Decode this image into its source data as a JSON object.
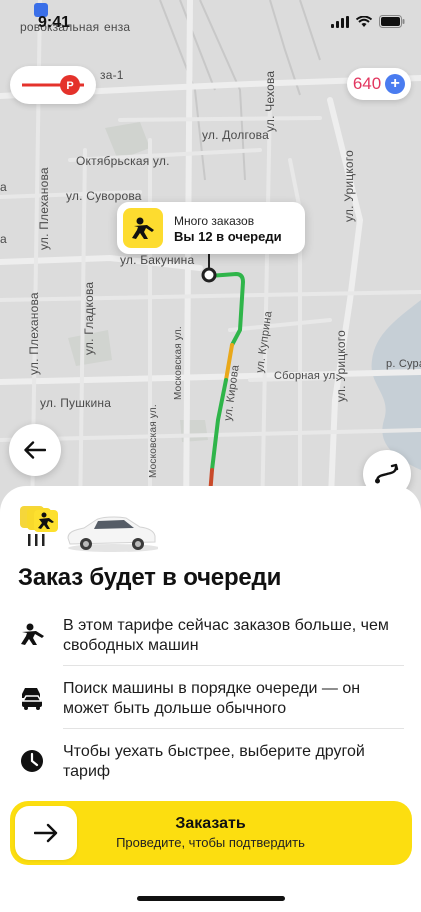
{
  "status_bar": {
    "time": "9:41"
  },
  "map": {
    "streets": {
      "top_left": "ровокзальная",
      "top_left_end": "енза",
      "za1": "за-1",
      "dolgova": "ул. Долгова",
      "oktyabrskaya": "Октябрьская ул.",
      "suvorova": "ул. Суворова",
      "bakunina": "ул. Бакунина",
      "chekhova": "ул. Чехова",
      "uritskogo_top": "ул. Урицкого",
      "uritskogo_bottom": "ул. Урицкого",
      "plekhanova_top": "ул. Плеханова",
      "plekhanova_bottom": "ул. Плеханова",
      "gladkova": "ул. Гладкова",
      "pushkina": "ул. Пушкина",
      "moskovskaya_top": "Московская ул.",
      "moskovskaya_bottom": "Московская ул.",
      "kuprina": "ул. Куприна",
      "sbornaya": "Сборная ул.",
      "kirova": "ул. Кирова",
      "sura": "р. Сура"
    },
    "points_badge": "640",
    "bubble": {
      "line1": "Много заказов",
      "line2": "Вы 12 в очереди"
    }
  },
  "sheet": {
    "title": "Заказ будет в очереди",
    "rows": [
      {
        "icon": "running-person-icon",
        "text": "В этом тарифе сейчас заказов больше, чем свободных машин"
      },
      {
        "icon": "cars-queue-icon",
        "text": "Поиск машины в порядке очереди — он может быть дольше обычного"
      },
      {
        "icon": "clock-icon",
        "text": "Чтобы уехать быстрее, выберите другой тариф"
      }
    ],
    "order_button": {
      "label": "Заказать",
      "sublabel": "Проведите, чтобы подтвердить"
    }
  },
  "colors": {
    "accent_yellow": "#fcde10",
    "points_red": "#e2365f",
    "route_green": "#2fb54a"
  }
}
